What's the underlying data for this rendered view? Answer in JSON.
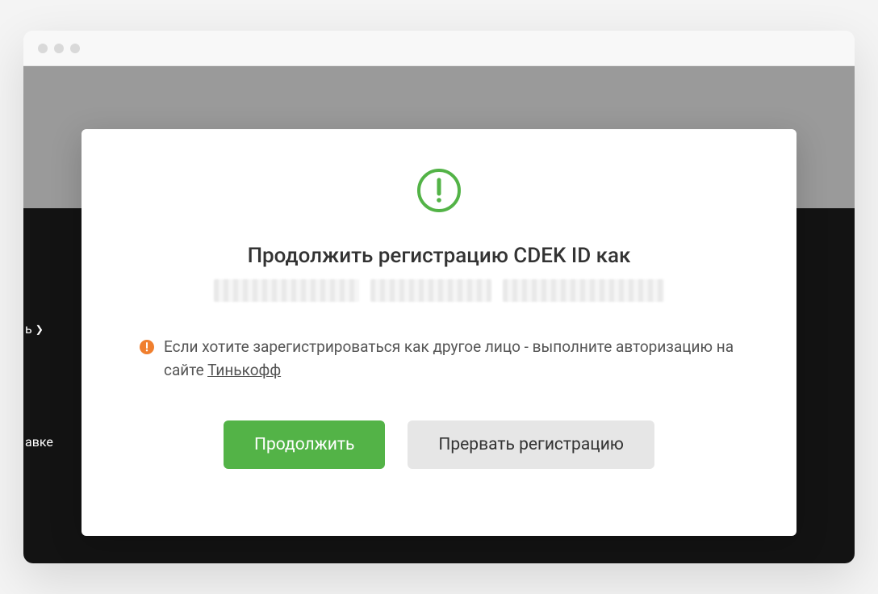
{
  "sidebar": {
    "fragment_a": "ь",
    "fragment_b": "авке"
  },
  "modal": {
    "title": "Продолжить регистрацию CDEK ID как",
    "note_prefix": "Если хотите зарегистрироваться как другое лицо - выполните авторизацию на сайте ",
    "note_link": "Тинькофф",
    "continue_label": "Продолжить",
    "cancel_label": "Прервать регистрацию"
  },
  "colors": {
    "accent_green": "#53b347",
    "alert_orange": "#f07f2e"
  }
}
